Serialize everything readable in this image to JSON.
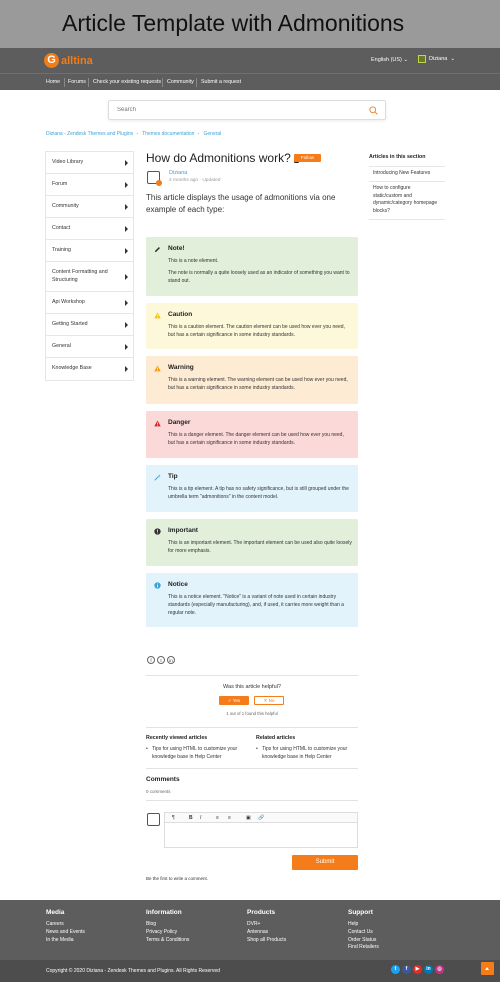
{
  "banner_title": "Article Template with Admonitions",
  "header": {
    "logo_mark": "G",
    "logo_text": "alltina",
    "language": "English (US)",
    "user_name": "Diziana"
  },
  "nav": [
    "Home",
    "Forums",
    "Check your existing requests",
    "Community",
    "Submit a request"
  ],
  "search": {
    "placeholder": "Search"
  },
  "breadcrumbs": [
    "Diziana - Zendesk Themes and Plugins",
    "Themes documentation",
    "General"
  ],
  "sidebar": [
    "Video Library",
    "Forum",
    "Community",
    "Contact",
    "Training",
    "Content Formatting and Structuring",
    "Api Workshop",
    "Getting Started",
    "General",
    "Knowledge Base"
  ],
  "article": {
    "title": "How do Admonitions work?",
    "follow_label": "Follow",
    "author": "Diziana",
    "meta": "2 months ago · Updated",
    "intro": "This article displays the usage of admonitions via one example of each type:"
  },
  "admonitions": [
    {
      "title": "Note!",
      "icon": "pencil-icon",
      "bg": "#e1efdb",
      "color": "#333333",
      "body": [
        "This is a note element.",
        "The note is normally a quite loosely used as an indicator of something you want to stand out."
      ]
    },
    {
      "title": "Caution",
      "icon": "caution-icon",
      "bg": "#fdf8da",
      "color": "#f1c40f",
      "body": [
        "This is a caution element. The caution element can be used how ever you need, but has a certain significance in some industry standards."
      ]
    },
    {
      "title": "Warning",
      "icon": "warning-icon",
      "bg": "#fdebd3",
      "color": "#f39c12",
      "body": [
        "This is a warning element. The warning element can be used how ever you need, but has a certain significance in some industry standards."
      ]
    },
    {
      "title": "Danger",
      "icon": "danger-icon",
      "bg": "#fbd9d9",
      "color": "#d9232d",
      "body": [
        "This is a danger element. The danger element can be used how ever you need, but has a certain significance in some industry standards."
      ]
    },
    {
      "title": "Tip",
      "icon": "tip-icon",
      "bg": "#e3f3fb",
      "color": "#3aa3d8",
      "body": [
        "This is a tip element. A tip has no safety significance, but is still grouped under the umbrella term \"admonitions\" in the content model."
      ]
    },
    {
      "title": "Important",
      "icon": "important-icon",
      "bg": "#e1efdb",
      "color": "#333333",
      "body": [
        "This is an important element. The important element can be used also quite loosely for more emphasis."
      ]
    },
    {
      "title": "Notice",
      "icon": "notice-icon",
      "bg": "#e3f3fb",
      "color": "#3aa3d8",
      "body": [
        "This is a notice element. \"Notice\" is a variant of note used in certain industry standards (especially manufacturing), and, if used, it carries more weight than a regular note."
      ]
    }
  ],
  "share_icons": [
    "f",
    "t",
    "in"
  ],
  "helpful": {
    "question": "Was this article helpful?",
    "yes": "✓ Yes",
    "no": "✕ No",
    "count": "1 out of 1 found this helpful"
  },
  "recently_viewed": {
    "title": "Recently viewed articles",
    "items": [
      "Tips for using HTML to customize your knowledge base in Help Center"
    ]
  },
  "related": {
    "title": "Related articles",
    "items": [
      "Tips for using HTML to customize your knowledge base in Help Center"
    ]
  },
  "comments": {
    "title": "Comments",
    "count": "0 comments",
    "submit": "Submit",
    "first": "Be the first to write a comment.",
    "toolbar": [
      "¶",
      "B",
      "I",
      "≡",
      "≡",
      "▣",
      "🔗"
    ]
  },
  "right_sidebar": {
    "title": "Articles in this section",
    "items": [
      "Introducing New Features",
      "How to configure static/custom and dynamic/category homepage blocks?"
    ]
  },
  "footer": {
    "columns": [
      {
        "title": "Media",
        "links": [
          "Careers",
          "News and Events",
          "In the Media"
        ]
      },
      {
        "title": "Information",
        "links": [
          "Blog",
          "Privacy Policy",
          "Terms & Conditions"
        ]
      },
      {
        "title": "Products",
        "links": [
          "DVR+",
          "Antennas",
          "Shop all Products"
        ]
      },
      {
        "title": "Support",
        "links": [
          "Help",
          "Contact Us",
          "Order Status",
          "Find Retailers"
        ]
      }
    ],
    "copyright": "Copyright © 2020 Diziana - Zendesk Themes and Plugins. All Rights Reserved",
    "social": [
      {
        "label": "t",
        "color": "#1da1f2"
      },
      {
        "label": "f",
        "color": "#3b5998"
      },
      {
        "label": "▶",
        "color": "#e52d27"
      },
      {
        "label": "in",
        "color": "#0077b5"
      },
      {
        "label": "◎",
        "color": "#c13584"
      }
    ]
  },
  "accent": "#f57c1a",
  "link_color": "#3aa3d8"
}
